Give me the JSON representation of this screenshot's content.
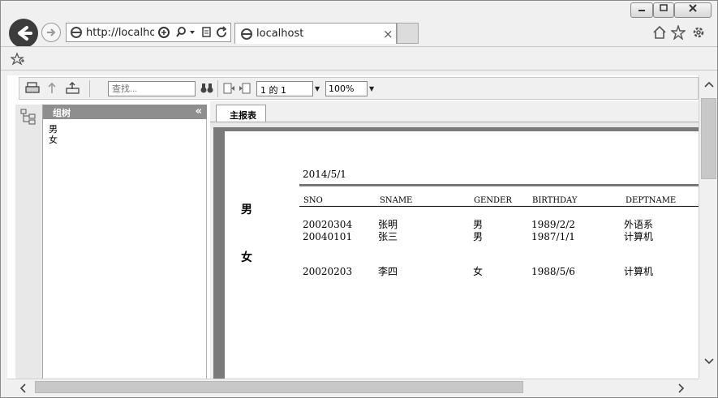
{
  "browser": {
    "address_url": "http://localhos",
    "tab_title": "localhost",
    "tab_close": "×"
  },
  "report_toolbar": {
    "search_placeholder": "查找...",
    "page_value": "1 的 1",
    "zoom_value": "100%"
  },
  "group_tree": {
    "title": "组树",
    "collapse": "«",
    "items": [
      "男",
      "女"
    ]
  },
  "report": {
    "tab_label": "主报表",
    "date": "2014/5/1",
    "columns": [
      "SNO",
      "SNAME",
      "GENDER",
      "BIRTHDAY",
      "DEPTNAME"
    ],
    "groups": [
      {
        "label": "男",
        "rows": [
          [
            "20020304",
            "张明",
            "男",
            "1989/2/2",
            "外语系"
          ],
          [
            "20040101",
            "张三",
            "男",
            "1987/1/1",
            "计算机"
          ]
        ]
      },
      {
        "label": "女",
        "rows": [
          [
            "20020203",
            "李四",
            "女",
            "1988/5/6",
            "计算机"
          ]
        ]
      }
    ]
  },
  "icons": {
    "back": "back-icon",
    "forward": "forward-icon",
    "home": "home-icon",
    "favorites": "star-icon",
    "settings": "gear-icon",
    "print": "printer-icon",
    "export": "export-icon",
    "find": "binoculars-icon",
    "group_tree_toggle": "tree-icon"
  }
}
